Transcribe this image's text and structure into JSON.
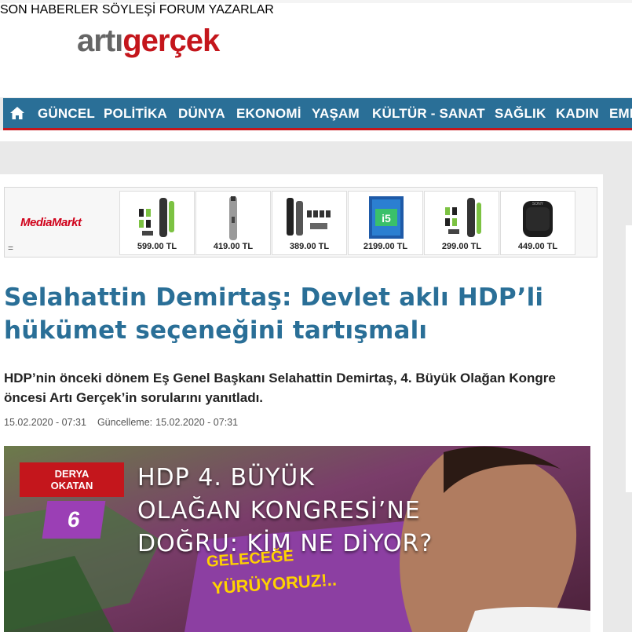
{
  "logo": {
    "part1": "artı",
    "part2": "gerçek"
  },
  "top_nav": [
    "SON HABERLER",
    "SÖYLEŞİ",
    "FORUM",
    "YAZARLAR"
  ],
  "main_nav": {
    "home_icon": "home-icon",
    "items": [
      "GÜNCEL",
      "POLİTİKA",
      "DÜNYA",
      "EKONOMİ",
      "YAŞAM",
      "KÜLTÜR - SANAT",
      "SAĞLIK",
      "KADIN",
      "EMEK"
    ]
  },
  "ad": {
    "brand": "MediaMarkt",
    "menu_glyph": "=",
    "products": [
      {
        "icon": "groomer-kit-icon",
        "price": "599.00 TL"
      },
      {
        "icon": "trimmer-icon",
        "price": "419.00 TL"
      },
      {
        "icon": "groomer-kit-icon",
        "price": "389.00 TL"
      },
      {
        "icon": "cpu-box-icon",
        "price": "2199.00 TL"
      },
      {
        "icon": "groomer-kit-icon",
        "price": "299.00 TL"
      },
      {
        "icon": "speaker-icon",
        "price": "449.00 TL"
      }
    ]
  },
  "article": {
    "title": "Selahattin Demirtaş: Devlet aklı HDP’li hükümet seçeneğini tartışmalı",
    "lead": "HDP’nin önceki dönem Eş Genel Başkanı Selahattin Demirtaş, 4. Büyük Olağan Kongre öncesi Artı Gerçek’in sorularını yanıtladı.",
    "published": "15.02.2020 - 07:31",
    "updated_label": "Güncelleme:",
    "updated": "15.02.2020 - 07:31"
  },
  "hero": {
    "tag_line1": "DERYA",
    "tag_line2": "OKATAN",
    "number": "6",
    "title_line1": "HDP 4. BÜYÜK",
    "title_line2": "OLAĞAN KONGRESİ’NE",
    "title_line3": "DOĞRU: KİM NE DİYOR?",
    "sign_line1": "GELECEĞE",
    "sign_line2": "YÜRÜYORUZ!.."
  },
  "colors": {
    "brand_red": "#c4161c",
    "nav_blue": "#2a6f97",
    "title_blue": "#2a6f97"
  }
}
